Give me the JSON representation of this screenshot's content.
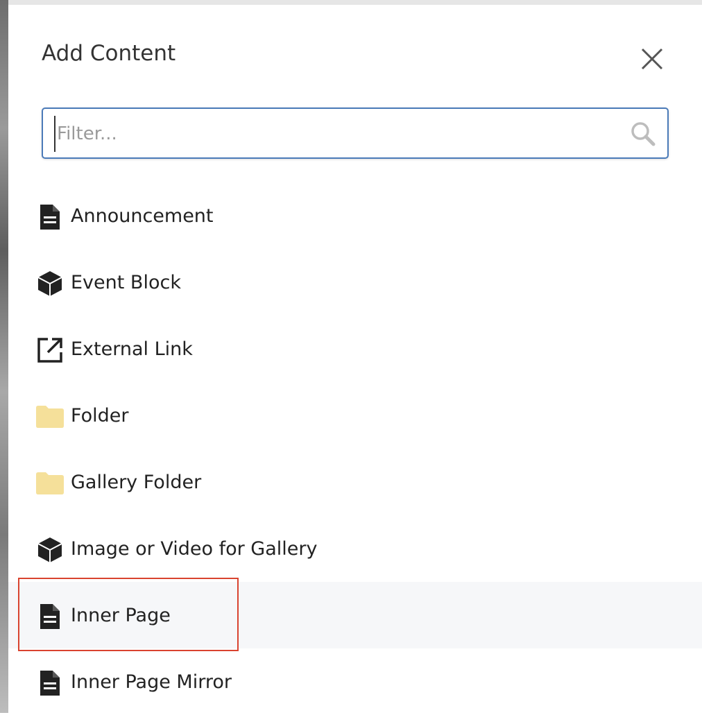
{
  "dialog": {
    "title": "Add Content",
    "close_icon": "close-icon"
  },
  "filter": {
    "placeholder": "Filter...",
    "value": "",
    "icon": "search-icon"
  },
  "items": [
    {
      "label": "Announcement",
      "icon": "document-icon"
    },
    {
      "label": "Event Block",
      "icon": "cube-icon"
    },
    {
      "label": "External Link",
      "icon": "external-link-icon"
    },
    {
      "label": "Folder",
      "icon": "folder-icon"
    },
    {
      "label": "Gallery Folder",
      "icon": "folder-icon"
    },
    {
      "label": "Image or Video for Gallery",
      "icon": "cube-icon"
    },
    {
      "label": "Inner Page",
      "icon": "document-icon",
      "hovered": true
    },
    {
      "label": "Inner Page Mirror",
      "icon": "document-icon"
    }
  ],
  "colors": {
    "folder": "#f5e09a",
    "highlight": "#d9432f",
    "focus_border": "#4a7ab8",
    "hover_row": "#f6f7f9"
  }
}
